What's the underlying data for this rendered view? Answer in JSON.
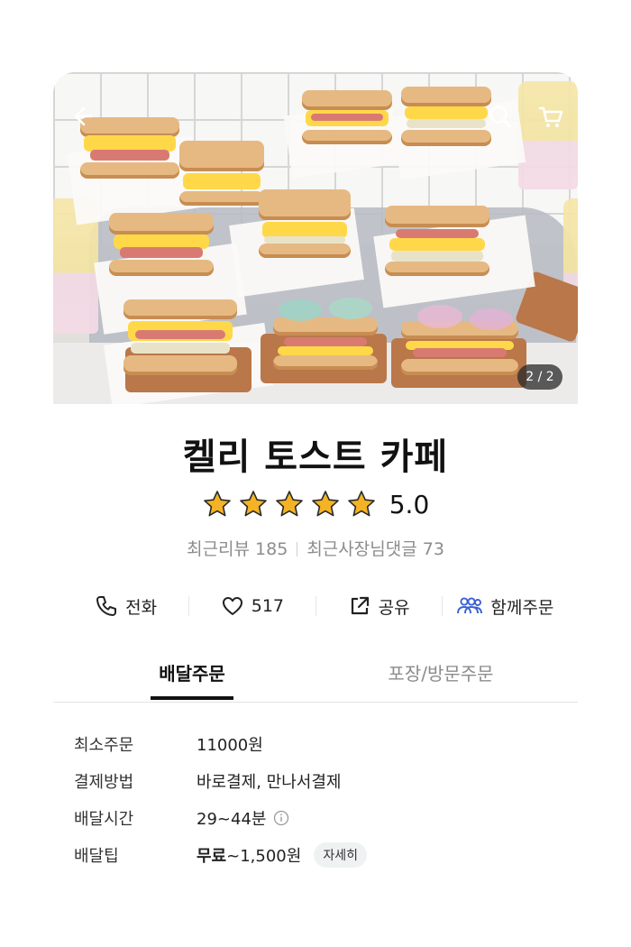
{
  "hero": {
    "page_indicator": "2 / 2",
    "back_icon": "arrow-left-icon",
    "search_icon": "search-icon",
    "cart_icon": "cart-icon"
  },
  "store": {
    "name": "켈리 토스트 카페",
    "rating": "5.0",
    "rating_stars": 5,
    "recent_reviews": "최근리뷰 185",
    "owner_replies": "최근사장님댓글 73",
    "star_color": "#f5b324"
  },
  "actions": [
    {
      "icon": "phone-icon",
      "label": "전화"
    },
    {
      "icon": "heart-icon",
      "label": "517"
    },
    {
      "icon": "share-icon",
      "label": "공유"
    },
    {
      "icon": "group-icon",
      "label": "함께주문",
      "color": "#3b5fd8"
    }
  ],
  "tabs": [
    {
      "label": "배달주문",
      "active": true
    },
    {
      "label": "포장/방문주문",
      "active": false
    }
  ],
  "info": {
    "min_order": {
      "key": "최소주문",
      "value": "11000원"
    },
    "payment": {
      "key": "결제방법",
      "value": "바로결제, 만나서결제"
    },
    "delivery_time": {
      "key": "배달시간",
      "value": "29~44분"
    },
    "delivery_tip": {
      "key": "배달팁",
      "value_bold": "무료",
      "value_rest": "~1,500원",
      "detail_label": "자세히"
    }
  }
}
